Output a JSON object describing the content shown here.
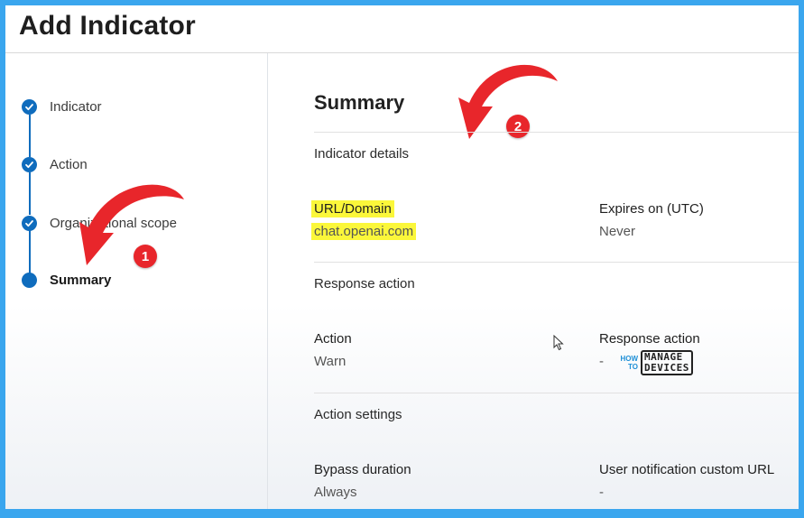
{
  "header": {
    "title": "Add Indicator"
  },
  "steps": [
    {
      "label": "Indicator",
      "state": "done"
    },
    {
      "label": "Action",
      "state": "done"
    },
    {
      "label": "Organizational scope",
      "state": "done"
    },
    {
      "label": "Summary",
      "state": "current"
    }
  ],
  "summary": {
    "title": "Summary",
    "indicator_details": {
      "heading": "Indicator details",
      "url_label": "URL/Domain",
      "url_value": "chat.openai.com",
      "expires_label": "Expires on (UTC)",
      "expires_value": "Never"
    },
    "response_action": {
      "heading": "Response action",
      "action_label": "Action",
      "action_value": "Warn",
      "response_label": "Response action",
      "response_value": "-"
    },
    "action_settings": {
      "heading": "Action settings",
      "bypass_label": "Bypass duration",
      "bypass_value": "Always",
      "notification_label": "User notification custom URL",
      "notification_value": "-"
    }
  },
  "annotations": {
    "badge1": "1",
    "badge2": "2",
    "arrow_color": "#e8262b"
  },
  "watermark": {
    "line1": "HOW",
    "line2": "TO",
    "word1": "MANAGE",
    "word2": "DEVICES"
  },
  "colors": {
    "accent": "#0f6cbd",
    "frame": "#3aa6ee",
    "highlight": "#fbf73a"
  }
}
